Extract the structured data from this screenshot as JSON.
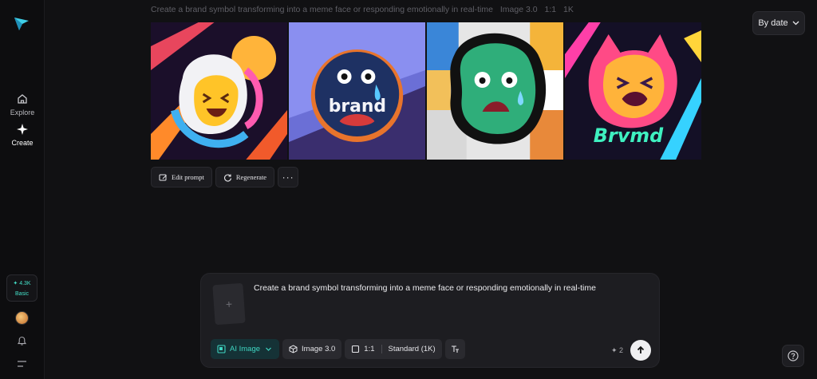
{
  "sidebar": {
    "nav": [
      {
        "label": "Explore",
        "icon": "home-icon"
      },
      {
        "label": "Create",
        "icon": "sparkle-icon"
      }
    ],
    "credits": {
      "amount": "✦ 4.3K",
      "plan": "Basic"
    }
  },
  "top_prompt": {
    "text": "Create a brand symbol transforming into a meme face or responding emotionally in real-time",
    "model": "Image 3.0",
    "ratio": "1:1",
    "resolution": "1K"
  },
  "sort": {
    "label": "By date"
  },
  "gallery": {
    "images": [
      {
        "name": "image-1",
        "text": ""
      },
      {
        "name": "image-2",
        "text": "brand"
      },
      {
        "name": "image-3",
        "text": ""
      },
      {
        "name": "image-4",
        "text": "Brvmd"
      }
    ]
  },
  "actions": {
    "edit_prompt": "Edit prompt",
    "regenerate": "Regenerate",
    "more": "···"
  },
  "composer": {
    "prompt": "Create a brand symbol transforming into a meme face or responding emotionally in real-time",
    "attach_symbol": "+",
    "mode": "AI Image",
    "model": "Image 3.0",
    "ratio": "1:1",
    "quality": "Standard (1K)",
    "cost": "✦ 2"
  },
  "colors": {
    "accent": "#3fd6c2",
    "background": "#111113"
  }
}
